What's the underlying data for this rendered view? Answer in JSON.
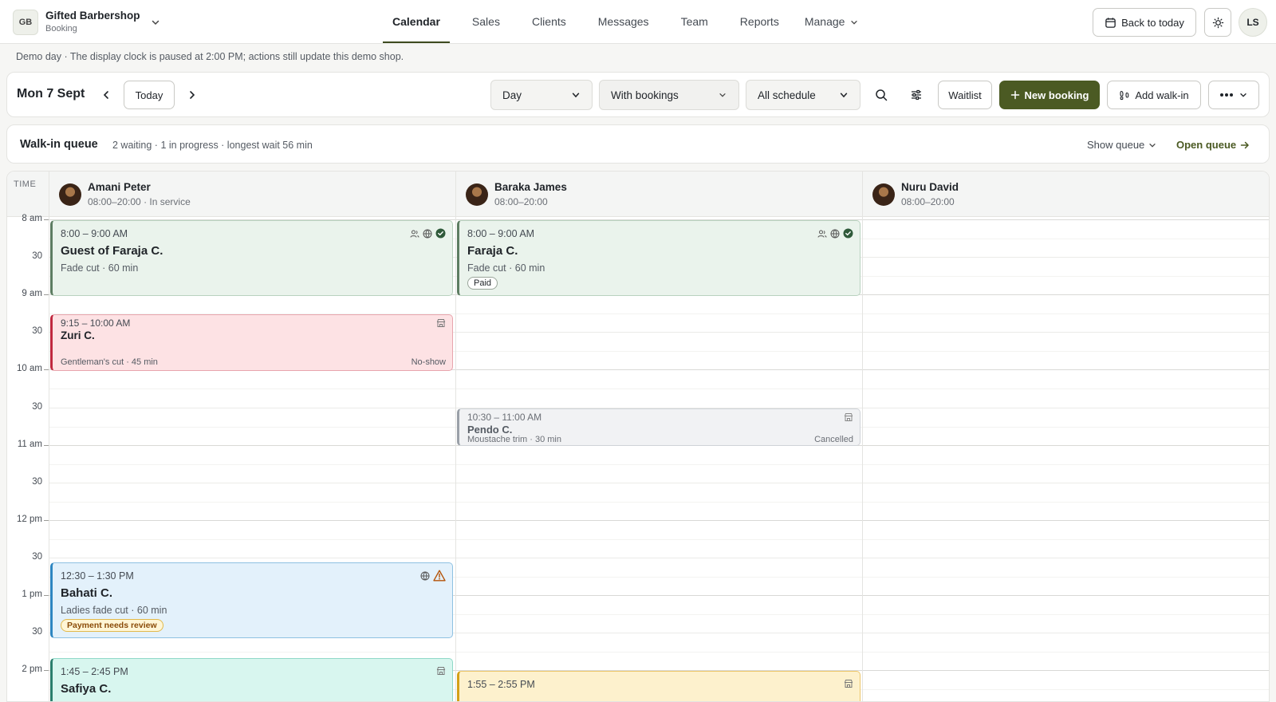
{
  "brand": {
    "initials": "GB",
    "name": "Gifted Barbershop",
    "subtitle": "Booking"
  },
  "nav": {
    "links": [
      "Calendar",
      "Sales",
      "Clients",
      "Messages",
      "Team",
      "Reports",
      "Manage"
    ],
    "active": "Calendar",
    "back_to_today": "Back to today",
    "user_initials": "LS"
  },
  "banner": "Demo day · The display clock is paused at 2:00 PM; actions still update this demo shop.",
  "toolbar": {
    "date": "Mon 7 Sept",
    "today": "Today",
    "view": "Day",
    "filter": "With bookings",
    "schedule": "All schedule",
    "waitlist": "Waitlist",
    "new_booking": "New booking",
    "add_walkin": "Add walk-in"
  },
  "queue": {
    "title": "Walk-in queue",
    "meta": "2 waiting · 1 in progress · longest wait 56 min",
    "show": "Show queue",
    "open": "Open queue"
  },
  "calendar": {
    "time_header": "TIME",
    "staff": [
      {
        "name": "Amani Peter",
        "hours": "08:00–20:00 · In service"
      },
      {
        "name": "Baraka James",
        "hours": "08:00–20:00"
      },
      {
        "name": "Nuru David",
        "hours": "08:00–20:00"
      }
    ],
    "time_labels": [
      "8 am",
      "30",
      "9 am",
      "30",
      "10 am",
      "30",
      "11 am",
      "30",
      "12 pm",
      "30",
      "1 pm",
      "30",
      "2 pm"
    ],
    "appointments": [
      {
        "time": "8:00 – 9:00 AM",
        "name": "Guest of Faraja C.",
        "service": "Fade cut · 60 min"
      },
      {
        "time": "8:00 – 9:00 AM",
        "name": "Faraja C.",
        "service": "Fade cut · 60 min",
        "badge": "Paid"
      },
      {
        "time": "9:15 – 10:00 AM",
        "name": "Zuri C.",
        "service": "Gentleman's cut · 45 min",
        "status": "No-show"
      },
      {
        "time": "10:30 – 11:00 AM",
        "name": "Pendo C.",
        "service": "Moustache trim · 30 min",
        "status": "Cancelled"
      },
      {
        "time": "12:30 – 1:30 PM",
        "name": "Bahati C.",
        "service": "Ladies fade cut · 60 min",
        "badge": "Payment needs review"
      },
      {
        "time": "1:45 – 2:45 PM",
        "name": "Safiya C."
      },
      {
        "time": "1:55 – 2:55 PM"
      }
    ]
  },
  "colors": {
    "accent": "#4b5a23",
    "confirmed": "#5d7d62",
    "no_show": "#c0283f",
    "cancelled": "#9aa0a8",
    "needs_review": "#2e86c1",
    "in_progress": "#2a7f6d",
    "walk_in": "#d4a017"
  }
}
